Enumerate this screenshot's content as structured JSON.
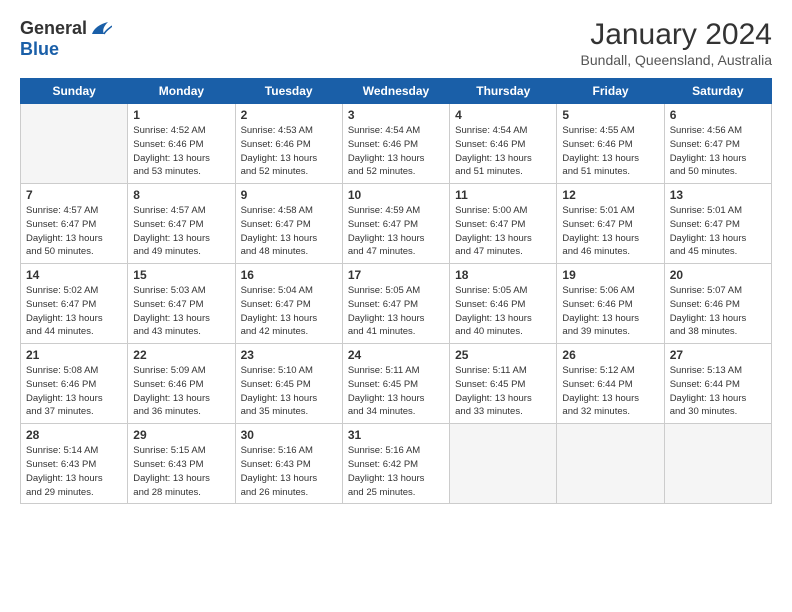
{
  "logo": {
    "general": "General",
    "blue": "Blue"
  },
  "title": "January 2024",
  "subtitle": "Bundall, Queensland, Australia",
  "days_header": [
    "Sunday",
    "Monday",
    "Tuesday",
    "Wednesday",
    "Thursday",
    "Friday",
    "Saturday"
  ],
  "weeks": [
    [
      {
        "num": "",
        "info": ""
      },
      {
        "num": "1",
        "info": "Sunrise: 4:52 AM\nSunset: 6:46 PM\nDaylight: 13 hours\nand 53 minutes."
      },
      {
        "num": "2",
        "info": "Sunrise: 4:53 AM\nSunset: 6:46 PM\nDaylight: 13 hours\nand 52 minutes."
      },
      {
        "num": "3",
        "info": "Sunrise: 4:54 AM\nSunset: 6:46 PM\nDaylight: 13 hours\nand 52 minutes."
      },
      {
        "num": "4",
        "info": "Sunrise: 4:54 AM\nSunset: 6:46 PM\nDaylight: 13 hours\nand 51 minutes."
      },
      {
        "num": "5",
        "info": "Sunrise: 4:55 AM\nSunset: 6:46 PM\nDaylight: 13 hours\nand 51 minutes."
      },
      {
        "num": "6",
        "info": "Sunrise: 4:56 AM\nSunset: 6:47 PM\nDaylight: 13 hours\nand 50 minutes."
      }
    ],
    [
      {
        "num": "7",
        "info": "Sunrise: 4:57 AM\nSunset: 6:47 PM\nDaylight: 13 hours\nand 50 minutes."
      },
      {
        "num": "8",
        "info": "Sunrise: 4:57 AM\nSunset: 6:47 PM\nDaylight: 13 hours\nand 49 minutes."
      },
      {
        "num": "9",
        "info": "Sunrise: 4:58 AM\nSunset: 6:47 PM\nDaylight: 13 hours\nand 48 minutes."
      },
      {
        "num": "10",
        "info": "Sunrise: 4:59 AM\nSunset: 6:47 PM\nDaylight: 13 hours\nand 47 minutes."
      },
      {
        "num": "11",
        "info": "Sunrise: 5:00 AM\nSunset: 6:47 PM\nDaylight: 13 hours\nand 47 minutes."
      },
      {
        "num": "12",
        "info": "Sunrise: 5:01 AM\nSunset: 6:47 PM\nDaylight: 13 hours\nand 46 minutes."
      },
      {
        "num": "13",
        "info": "Sunrise: 5:01 AM\nSunset: 6:47 PM\nDaylight: 13 hours\nand 45 minutes."
      }
    ],
    [
      {
        "num": "14",
        "info": "Sunrise: 5:02 AM\nSunset: 6:47 PM\nDaylight: 13 hours\nand 44 minutes."
      },
      {
        "num": "15",
        "info": "Sunrise: 5:03 AM\nSunset: 6:47 PM\nDaylight: 13 hours\nand 43 minutes."
      },
      {
        "num": "16",
        "info": "Sunrise: 5:04 AM\nSunset: 6:47 PM\nDaylight: 13 hours\nand 42 minutes."
      },
      {
        "num": "17",
        "info": "Sunrise: 5:05 AM\nSunset: 6:47 PM\nDaylight: 13 hours\nand 41 minutes."
      },
      {
        "num": "18",
        "info": "Sunrise: 5:05 AM\nSunset: 6:46 PM\nDaylight: 13 hours\nand 40 minutes."
      },
      {
        "num": "19",
        "info": "Sunrise: 5:06 AM\nSunset: 6:46 PM\nDaylight: 13 hours\nand 39 minutes."
      },
      {
        "num": "20",
        "info": "Sunrise: 5:07 AM\nSunset: 6:46 PM\nDaylight: 13 hours\nand 38 minutes."
      }
    ],
    [
      {
        "num": "21",
        "info": "Sunrise: 5:08 AM\nSunset: 6:46 PM\nDaylight: 13 hours\nand 37 minutes."
      },
      {
        "num": "22",
        "info": "Sunrise: 5:09 AM\nSunset: 6:46 PM\nDaylight: 13 hours\nand 36 minutes."
      },
      {
        "num": "23",
        "info": "Sunrise: 5:10 AM\nSunset: 6:45 PM\nDaylight: 13 hours\nand 35 minutes."
      },
      {
        "num": "24",
        "info": "Sunrise: 5:11 AM\nSunset: 6:45 PM\nDaylight: 13 hours\nand 34 minutes."
      },
      {
        "num": "25",
        "info": "Sunrise: 5:11 AM\nSunset: 6:45 PM\nDaylight: 13 hours\nand 33 minutes."
      },
      {
        "num": "26",
        "info": "Sunrise: 5:12 AM\nSunset: 6:44 PM\nDaylight: 13 hours\nand 32 minutes."
      },
      {
        "num": "27",
        "info": "Sunrise: 5:13 AM\nSunset: 6:44 PM\nDaylight: 13 hours\nand 30 minutes."
      }
    ],
    [
      {
        "num": "28",
        "info": "Sunrise: 5:14 AM\nSunset: 6:43 PM\nDaylight: 13 hours\nand 29 minutes."
      },
      {
        "num": "29",
        "info": "Sunrise: 5:15 AM\nSunset: 6:43 PM\nDaylight: 13 hours\nand 28 minutes."
      },
      {
        "num": "30",
        "info": "Sunrise: 5:16 AM\nSunset: 6:43 PM\nDaylight: 13 hours\nand 26 minutes."
      },
      {
        "num": "31",
        "info": "Sunrise: 5:16 AM\nSunset: 6:42 PM\nDaylight: 13 hours\nand 25 minutes."
      },
      {
        "num": "",
        "info": ""
      },
      {
        "num": "",
        "info": ""
      },
      {
        "num": "",
        "info": ""
      }
    ]
  ]
}
